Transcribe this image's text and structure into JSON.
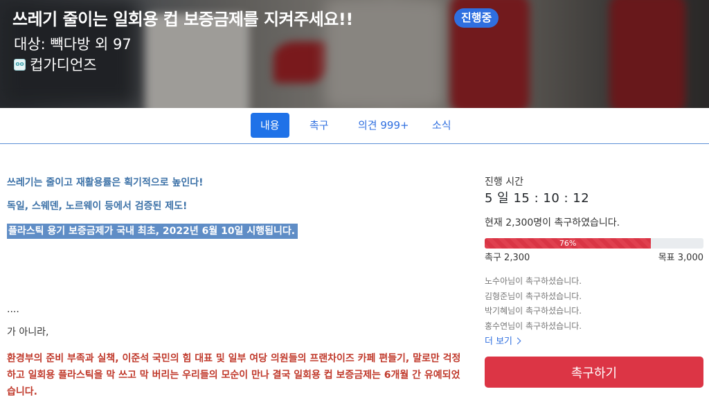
{
  "hero": {
    "title": "쓰레기 줄이는 일회용 컵 보증금제를 지켜주세요!!",
    "status_badge": "진행중",
    "target": "대상: 빽다방 외 97",
    "org_name": "컵가디언즈",
    "org_icon": "cup-guardians-logo-icon"
  },
  "tabs": [
    {
      "label": "내용",
      "active": true
    },
    {
      "label": "촉구",
      "active": false
    },
    {
      "label": "의견 999+",
      "active": false
    },
    {
      "label": "소식",
      "active": false
    }
  ],
  "content": {
    "headline1": "쓰레기는 줄이고 재활용률은 획기적으로 높인다!",
    "headline2": "독일, 스웨덴, 노르웨이 등에서 검증된 제도!",
    "headline3": "플라스틱 용기 보증금제가 국내 최초, 2022년 6월 10일 시행됩니다.",
    "dots": "....",
    "not_but": "가 아니라,",
    "red_paragraph": "환경부의 준비 부족과 실책, 이준석 국민의 힘 대표 및 일부 여당 의원들의 프랜차이즈 카페 편들기, 말로만 걱정하고 일회용 플라스틱을 막 쓰고 막 버리는 우리들의 모순이 만나 결국 일회용 컵 보증금제는 6개월 간 유예되었습니다."
  },
  "sidebar": {
    "time_label": "진행 시간",
    "timer": "5 일 15 : 10 : 12",
    "current": "현재 2,300명이 촉구하였습니다.",
    "progress_label": "76%",
    "progress_fraction": 0.76,
    "demand_count": "촉구 2,300",
    "goal": "목표 3,000",
    "supporters": [
      "노수아님이 촉구하셨습니다.",
      "김형준님이 촉구하셨습니다.",
      "박기혜님이 촉구하셨습니다.",
      "홍수연님이 촉구하셨습니다."
    ],
    "more_label": "더 보기",
    "button_label": "촉구하기"
  },
  "colors": {
    "primary": "#1f72e8",
    "danger": "#dc3545",
    "headline_blue": "#3d72a8",
    "paragraph_red": "#c0392b"
  }
}
